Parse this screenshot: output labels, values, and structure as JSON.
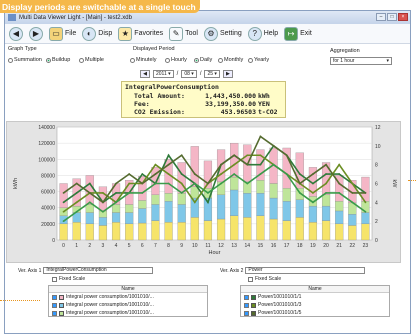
{
  "banner": "Display periods are switchable at a single touch",
  "window": {
    "title": "Multi Data Viewer Light - [Main] - test2.xdb"
  },
  "toolbar": {
    "items": [
      "File",
      "Disp",
      "Favorites",
      "Tool",
      "Setting",
      "Help",
      "Exit"
    ]
  },
  "graph_type": {
    "label": "Graph Type",
    "options": [
      "Summation",
      "Buildup",
      "Multiple"
    ],
    "selected": "Buildup"
  },
  "displayed_period": {
    "label": "Displayed Period",
    "options": [
      "Minutely",
      "Hourly",
      "Daily",
      "Monthly",
      "Yearly"
    ],
    "selected": "Daily"
  },
  "aggregation": {
    "label": "Aggregation",
    "value": "for 1 hour"
  },
  "date": {
    "year": "2011",
    "month": "08",
    "day": "25"
  },
  "summary": {
    "title": "IntegralPowerConsumption",
    "rows": [
      {
        "k": "Total Amount:",
        "v": "1,443,450.000",
        "u": "kWh"
      },
      {
        "k": "Fee:",
        "v": "33,199,350.00",
        "u": "YEN"
      },
      {
        "k": "CO2 Emission:",
        "v": "453.96503",
        "u": "t-CO2"
      }
    ]
  },
  "chart_data": {
    "type": "bar",
    "x": [
      "0",
      "1",
      "2",
      "3",
      "4",
      "5",
      "6",
      "7",
      "8",
      "9",
      "10",
      "11",
      "12",
      "13",
      "14",
      "15",
      "16",
      "17",
      "18",
      "19",
      "20",
      "21",
      "22",
      "23"
    ],
    "xlabel": "Hour",
    "ylabel": "kWh",
    "y2label": "kW",
    "ylim": [
      0,
      140000
    ],
    "y2lim": [
      0,
      12
    ],
    "yticks": [
      "140000",
      "120000",
      "100000",
      "80000",
      "60000",
      "40000",
      "20000",
      "0"
    ],
    "y2ticks": [
      "12",
      "10",
      "8",
      "6",
      "4",
      "2",
      "0"
    ],
    "series": [
      {
        "color": "#f6e46a",
        "values": [
          20000,
          22000,
          20000,
          18000,
          22000,
          20000,
          21000,
          24000,
          22000,
          22000,
          28000,
          24000,
          26000,
          30000,
          28000,
          30000,
          26000,
          24000,
          28000,
          22000,
          24000,
          20000,
          18000,
          20000
        ]
      },
      {
        "color": "#7fc7e8",
        "values": [
          10000,
          12000,
          14000,
          10000,
          12000,
          14000,
          18000,
          20000,
          26000,
          22000,
          24000,
          28000,
          30000,
          32000,
          30000,
          28000,
          26000,
          24000,
          22000,
          20000,
          18000,
          16000,
          14000,
          14000
        ]
      },
      {
        "color": "#bfe59a",
        "values": [
          10000,
          8000,
          10000,
          8000,
          10000,
          10000,
          10000,
          12000,
          10000,
          14000,
          14000,
          12000,
          16000,
          16000,
          14000,
          16000,
          18000,
          16000,
          14000,
          12000,
          14000,
          12000,
          14000,
          14000
        ]
      },
      {
        "color": "#f4b6c6",
        "values": [
          30000,
          34000,
          36000,
          30000,
          26000,
          30000,
          30000,
          34000,
          42000,
          38000,
          50000,
          34000,
          40000,
          42000,
          46000,
          38000,
          44000,
          50000,
          44000,
          36000,
          40000,
          32000,
          28000,
          30000
        ]
      }
    ],
    "lines": [
      {
        "color": "#2f7a3a",
        "values": [
          4,
          5,
          6,
          4,
          5,
          5,
          7,
          6,
          9,
          7,
          6,
          4,
          8,
          9,
          8,
          8,
          10,
          9,
          7,
          6,
          7,
          7,
          6,
          5
        ]
      },
      {
        "color": "#6b8e23",
        "values": [
          3,
          4,
          5,
          5,
          4,
          6,
          6,
          8,
          7,
          6,
          4,
          6,
          7,
          8,
          9,
          9,
          8,
          7,
          6,
          5,
          6,
          8,
          6,
          4
        ]
      },
      {
        "color": "#556b2f",
        "values": [
          5,
          6,
          5,
          4,
          6,
          7,
          6,
          7,
          8,
          9,
          7,
          6,
          8,
          9,
          8,
          11,
          10,
          9,
          6,
          7,
          8,
          6,
          5,
          5
        ]
      },
      {
        "color": "#3a9b4a",
        "values": [
          2,
          3,
          4,
          3,
          4,
          5,
          5,
          6,
          6,
          5,
          6,
          5,
          6,
          7,
          6,
          7,
          8,
          7,
          5,
          4,
          5,
          5,
          4,
          3
        ]
      }
    ]
  },
  "axis1": {
    "label": "Ver. Axis 1",
    "value": "IntegralPowerConsumption",
    "fixed": "Fixed Scale"
  },
  "axis2": {
    "label": "Ver. Axis 2",
    "value": "Power",
    "fixed": "Fixed Scale"
  },
  "list1": {
    "header": "Name",
    "items": [
      {
        "name": "Integral power consumption/1001010/...",
        "color": "#f4b6c6"
      },
      {
        "name": "Integral power consumption/1001010/...",
        "color": "#7fc7e8"
      },
      {
        "name": "Integral power consumption/1001010/...",
        "color": "#bfe59a"
      }
    ]
  },
  "list2": {
    "header": "Name",
    "items": [
      {
        "name": "Power/1001010/1/1",
        "color": "#2f7a3a"
      },
      {
        "name": "Power/1001010/1/3",
        "color": "#6b8e23"
      },
      {
        "name": "Power/1001010/1/5",
        "color": "#556b2f"
      }
    ]
  }
}
